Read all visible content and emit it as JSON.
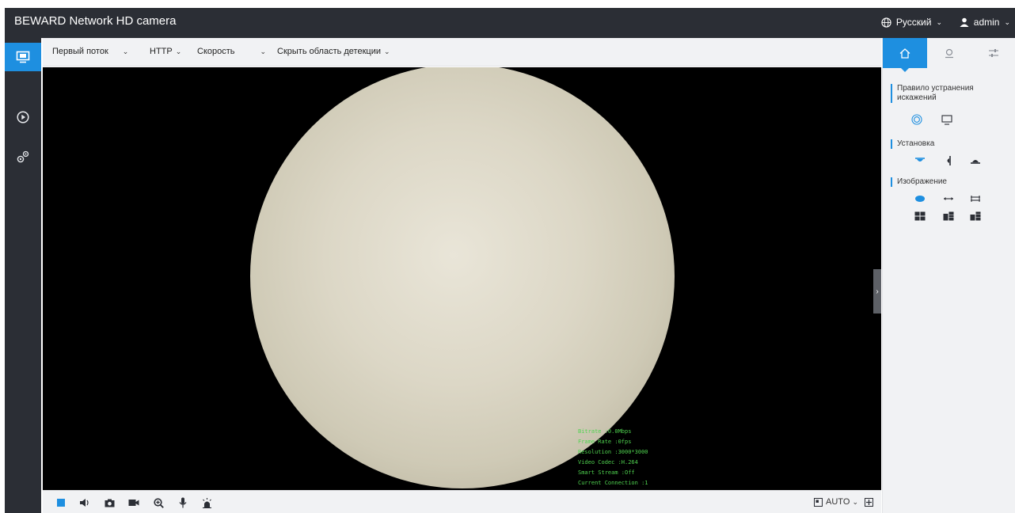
{
  "header": {
    "title": "BEWARD Network HD camera",
    "language": "Русский",
    "user": "admin"
  },
  "toolbar": {
    "stream": "Первый поток",
    "protocol": "HTTP",
    "speed": "Скорость",
    "detection": "Скрыть область детекции"
  },
  "osd": {
    "line1": "Bitrate :0.0Mbps",
    "line2": "Frame Rate :0fps",
    "line3": "Resolution :3000*3000",
    "line4": "Video Codec :H.264",
    "line5": "Smart Stream :Off",
    "line6": "Current Connection :1"
  },
  "bottombar": {
    "auto_label": "AUTO"
  },
  "right_panel": {
    "section1": "Правило устранения искажений",
    "section2": "Установка",
    "section3": "Изображение"
  },
  "colors": {
    "accent": "#1e8fe0",
    "dark": "#2b2e35",
    "osd_text": "#4fd24f"
  }
}
